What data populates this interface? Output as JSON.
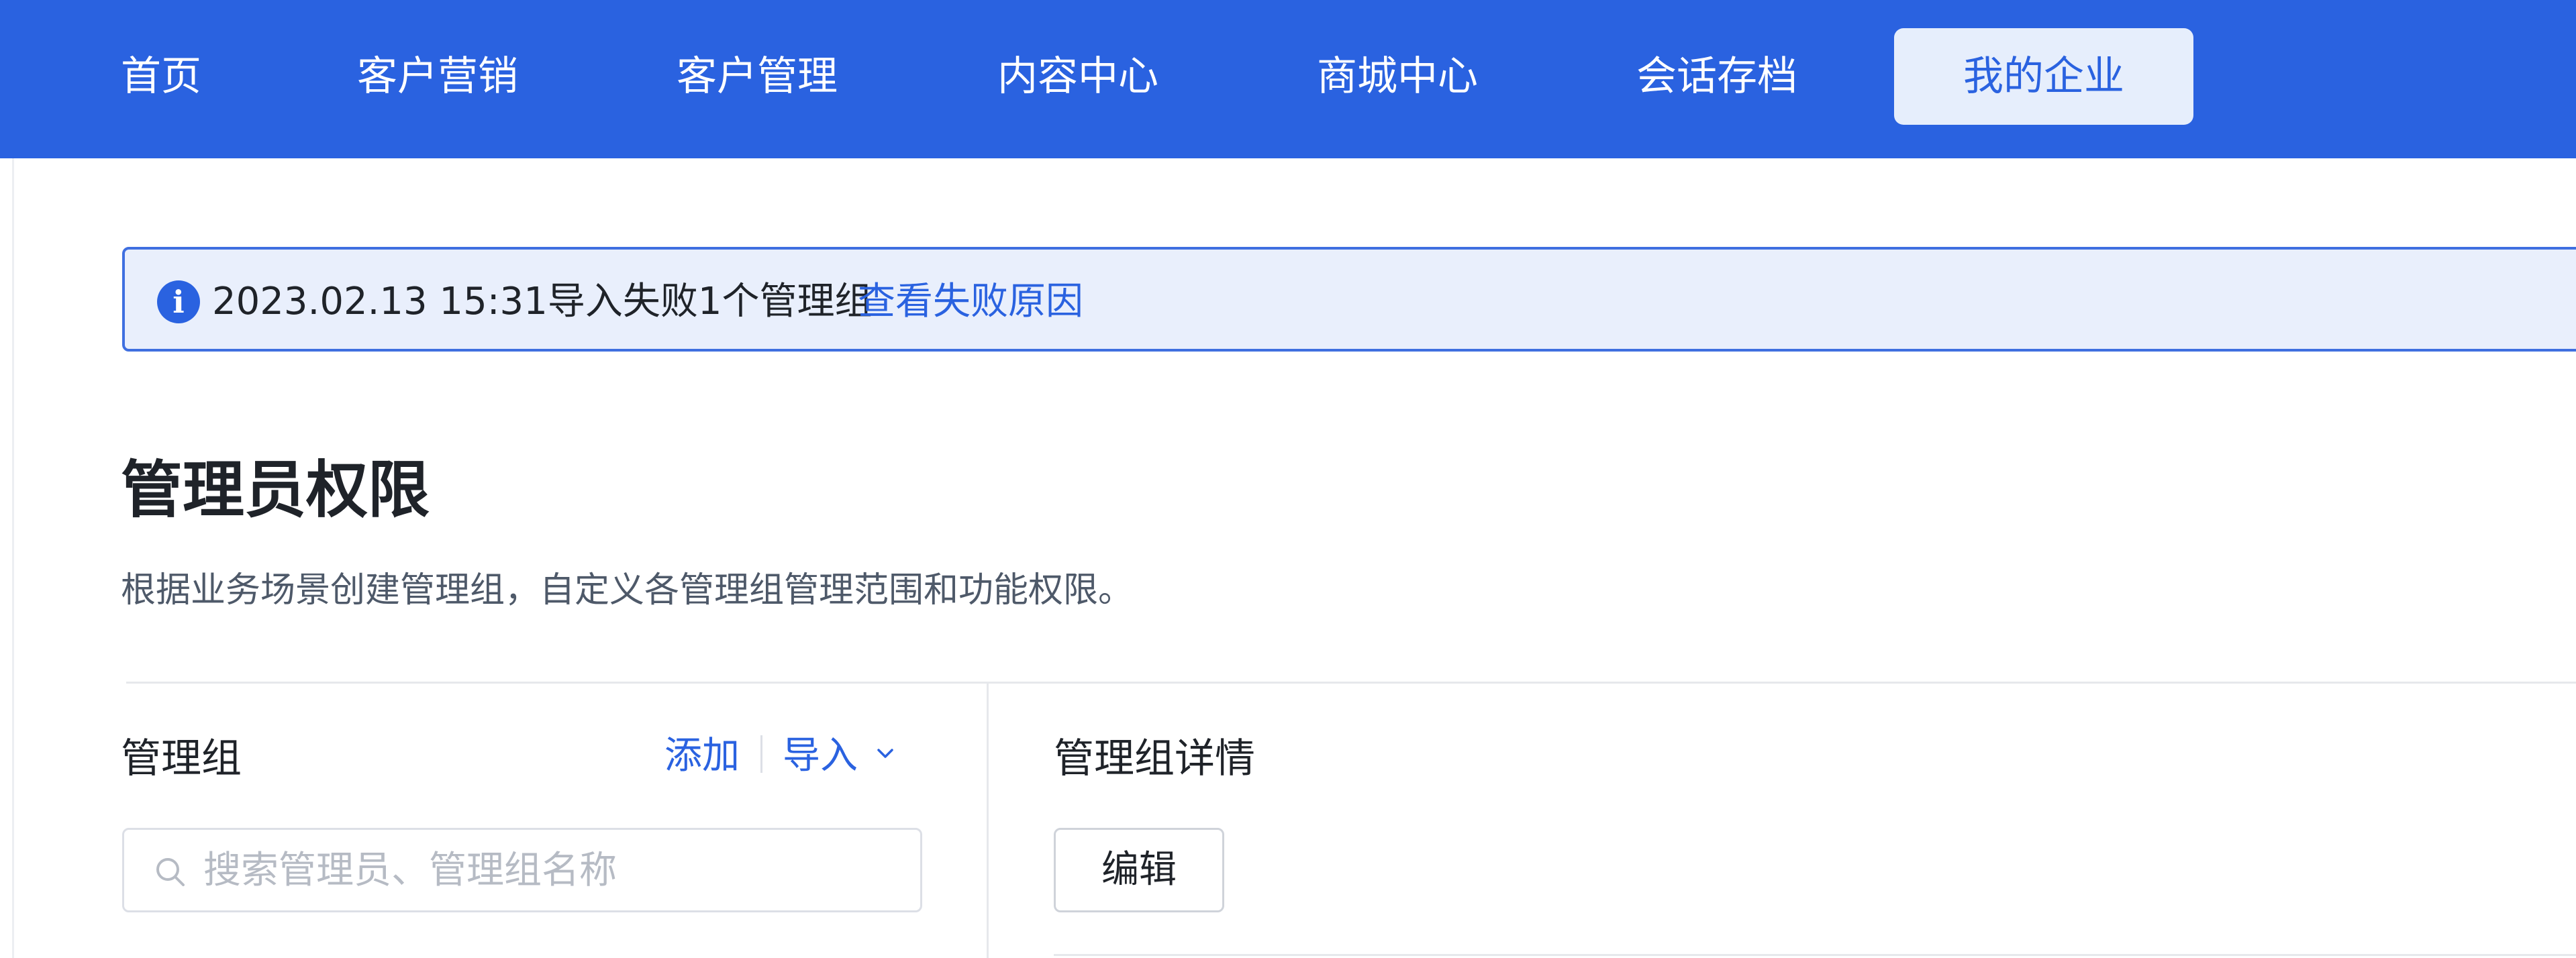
{
  "nav": {
    "items": [
      {
        "label": "首页"
      },
      {
        "label": "客户营销"
      },
      {
        "label": "客户管理"
      },
      {
        "label": "内容中心"
      },
      {
        "label": "商城中心"
      },
      {
        "label": "会话存档"
      },
      {
        "label": "我的企业",
        "active": true
      }
    ]
  },
  "alert": {
    "icon": "info-icon",
    "message": "2023.02.13 15:31导入失败1个管理组",
    "link": "查看失败原因"
  },
  "page": {
    "title": "管理员权限",
    "description": "根据业务场景创建管理组，自定义各管理组管理范围和功能权限。"
  },
  "left_panel": {
    "title": "管理组",
    "add_label": "添加",
    "import_label": "导入",
    "search_placeholder": "搜索管理员、管理组名称",
    "search_value": ""
  },
  "right_panel": {
    "title": "管理组详情",
    "edit_label": "编辑"
  },
  "colors": {
    "nav_bg": "#2a62e0",
    "accent": "#2a62e0",
    "alert_bg": "#e9effc"
  }
}
